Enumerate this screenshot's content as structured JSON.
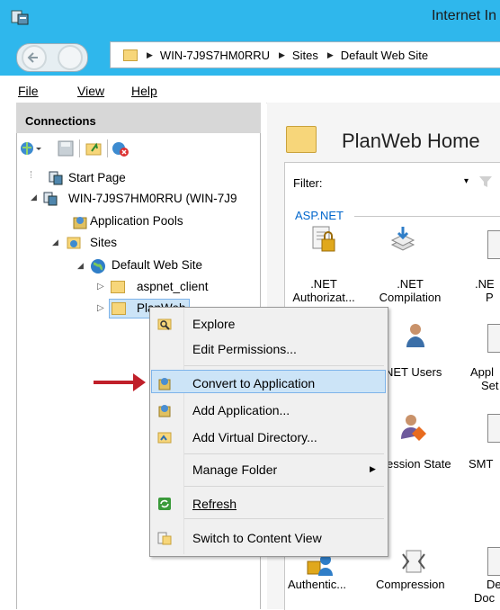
{
  "window": {
    "title": "Internet In"
  },
  "address": {
    "crumbs": [
      "WIN-7J9S7HM0RRU",
      "Sites",
      "Default Web Site"
    ]
  },
  "menu": {
    "file": "File",
    "view": "View",
    "help": "Help"
  },
  "connections": {
    "title": "Connections",
    "tree": {
      "start_page": "Start Page",
      "server": "WIN-7J9S7HM0RRU (WIN-7J9",
      "app_pools": "Application Pools",
      "sites": "Sites",
      "default_site": "Default Web Site",
      "aspnet_client": "aspnet_client",
      "planweb": "PlanWeb"
    }
  },
  "main": {
    "title": "PlanWeb Home",
    "filter_label": "Filter:",
    "section": "ASP.NET",
    "features": {
      "auth": ".NET\nAuthorizat...",
      "compilation": ".NET\nCompilation",
      "third": ".NE\nP",
      "net_users": "NET Users",
      "app_settings": "Appl\nSet",
      "session_state": "ession State",
      "smtp": "SMT",
      "authentic": "Authentic...",
      "compression": "Compression",
      "default_doc": "De\nDoc"
    }
  },
  "context_menu": {
    "explore": "Explore",
    "edit_permissions": "Edit Permissions...",
    "convert": "Convert to Application",
    "add_application": "Add Application...",
    "add_vdir": "Add Virtual Directory...",
    "manage_folder": "Manage Folder",
    "refresh": "Refresh",
    "switch_content": "Switch to Content View"
  },
  "colors": {
    "accent": "#2fb7ec",
    "highlight": "#cce4f7",
    "arrow": "#c0202a"
  }
}
